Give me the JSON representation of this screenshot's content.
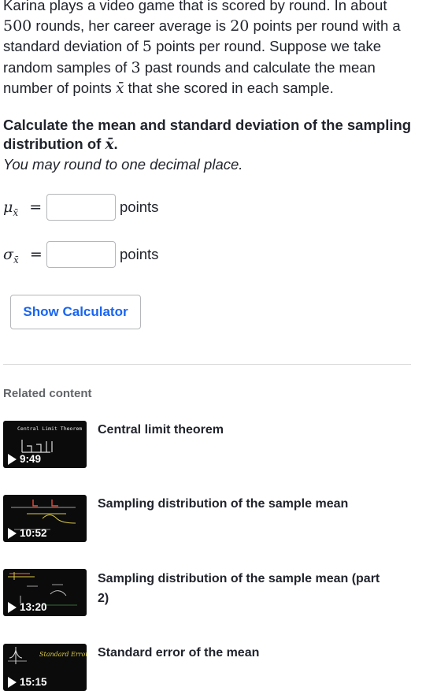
{
  "problem": {
    "p1": "Karina plays a video game that is scored by round. In about ",
    "n_total": "500",
    "p2": " rounds, her career average is ",
    "mean": "20",
    "p3": " points per round with a standard deviation of ",
    "sd": "5",
    "p4": " points per round. Suppose we take random samples of ",
    "n": "3",
    "p5": " past rounds and calculate the mean number of points ",
    "xbar": "x̄",
    "p6": " that she scored in each sample."
  },
  "question": {
    "bold_text": "Calculate the mean and standard deviation of the sampling distribution of ",
    "bold_xbar": "x̄",
    "bold_end": ".",
    "italic_text": "You may round to one decimal place."
  },
  "answers": {
    "mu_symbol": "μ",
    "sigma_symbol": "σ",
    "sub": "x̄",
    "equals": "=",
    "mu_value": "",
    "sigma_value": "",
    "unit": "points"
  },
  "calculator": {
    "label": "Show Calculator"
  },
  "related": {
    "heading": "Related content",
    "videos": [
      {
        "title": "Central limit theorem",
        "duration": "9:49",
        "thumb_text": "Central Limit Theorem"
      },
      {
        "title": "Sampling distribution of the sample mean",
        "duration": "10:52"
      },
      {
        "title": "Sampling distribution of the sample mean (part 2)",
        "duration": "13:20"
      },
      {
        "title": "Standard error of the mean",
        "duration": "15:15",
        "thumb_text": "Standard Error"
      }
    ]
  }
}
